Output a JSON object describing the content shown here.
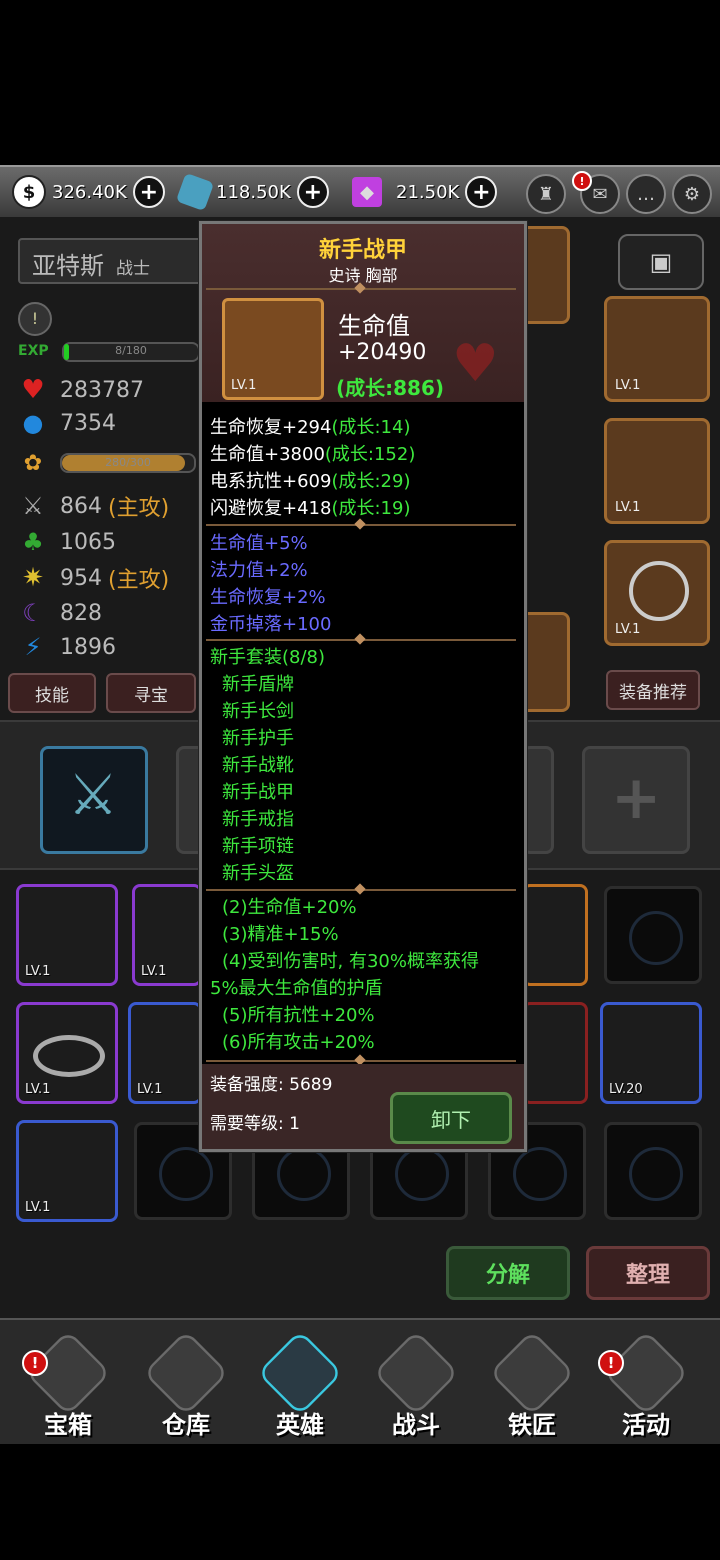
{
  "currency": {
    "gold_symbol": "$",
    "gold": "326.40K",
    "crystal": "118.50K",
    "gem": "21.50K"
  },
  "hero": {
    "name": "亚特斯",
    "class": "战士",
    "exp_label": "EXP",
    "exp_text": "8/180",
    "hp": "283787",
    "mp": "7354",
    "energy_text": "280/300",
    "attack": "864",
    "attack_tag": "(主攻)",
    "defense": "1065",
    "magic_attack": "954",
    "magic_tag": "(主攻)",
    "magic_defense": "828",
    "speed": "1896"
  },
  "side_buttons": {
    "skill": "技能",
    "seek": "寻宝",
    "recommend": "装备推荐"
  },
  "equip_levels": {
    "armor": "LV.1",
    "gauntlet": "LV.1",
    "shield": "LV.1"
  },
  "inventory": {
    "row1": [
      "LV.1",
      "LV.1"
    ],
    "row2": [
      "LV.1",
      "LV.1",
      "LV.20"
    ],
    "row3": [
      "LV.1"
    ]
  },
  "popup": {
    "title": "新手战甲",
    "subtitle": "史诗  胸部",
    "item_level": "LV.1",
    "main_stat_name": "生命值",
    "main_stat_value": "+20490",
    "main_stat_growth": "(成长:886)",
    "base_stats": [
      {
        "text": "生命恢复+294",
        "growth": "(成长:14)"
      },
      {
        "text": "生命值+3800",
        "growth": "(成长:152)"
      },
      {
        "text": "电系抗性+609",
        "growth": "(成长:29)"
      },
      {
        "text": "闪避恢复+418",
        "growth": "(成长:19)"
      }
    ],
    "bonus_stats": [
      "生命值+5%",
      "法力值+2%",
      "生命恢复+2%",
      "金币掉落+100"
    ],
    "set_name": "新手套装(8/8)",
    "set_items": [
      "新手盾牌",
      "新手长剑",
      "新手护手",
      "新手战靴",
      "新手战甲",
      "新手戒指",
      "新手项链",
      "新手头盔"
    ],
    "set_bonuses": [
      "(2)生命值+20%",
      "(3)精准+15%",
      "(4)受到伤害时, 有30%概率获得",
      "5%最大生命值的护盾",
      "(5)所有抗性+20%",
      "(6)所有攻击+20%"
    ],
    "strength": "装备强度: 5689",
    "required_level": "需要等级: 1",
    "unequip_label": "卸下"
  },
  "actions": {
    "decompose": "分解",
    "sort": "整理"
  },
  "nav": [
    {
      "label": "宝箱",
      "badge": "!"
    },
    {
      "label": "仓库",
      "badge": ""
    },
    {
      "label": "英雄",
      "badge": ""
    },
    {
      "label": "战斗",
      "badge": ""
    },
    {
      "label": "铁匠",
      "badge": ""
    },
    {
      "label": "活动",
      "badge": "!"
    }
  ],
  "colors": {
    "green_text": "#3ee83e",
    "blue_text": "#6a6aff",
    "accent_gold": "#ffd23a"
  }
}
